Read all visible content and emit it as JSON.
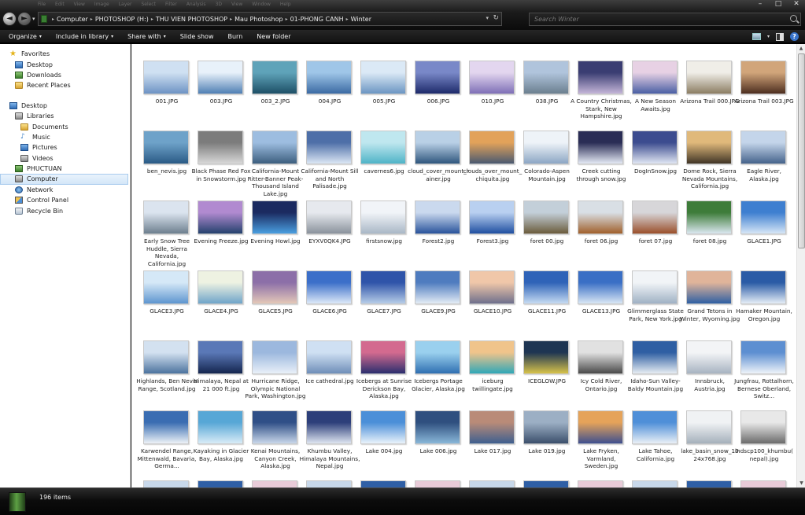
{
  "window": {
    "menu_ghost": [
      "File",
      "Edit",
      "View",
      "Image",
      "Layer",
      "Select",
      "Filter",
      "Analysis",
      "3D",
      "View",
      "Window",
      "Help"
    ],
    "controls": {
      "minimize": "–",
      "maximize": "□",
      "close": "✕"
    }
  },
  "nav": {
    "back": "◄",
    "forward": "►",
    "history": "▾"
  },
  "address": {
    "crumbs": [
      "Computer",
      "PHOTOSHOP (H:)",
      "THU VIEN PHOTOSHOP",
      "Mau Photoshop",
      "01-PHONG CANH",
      "Winter"
    ],
    "separator": "▸",
    "dropdown": "▾",
    "refresh": "↻"
  },
  "search": {
    "placeholder": "Search Winter"
  },
  "toolbar": {
    "organize": "Organize",
    "include": "Include in library",
    "share": "Share with",
    "slideshow": "Slide show",
    "burn": "Burn",
    "newfolder": "New folder",
    "caret": "▾",
    "help": "?"
  },
  "sidebar": {
    "favorites": {
      "label": "Favorites",
      "items": [
        "Desktop",
        "Downloads",
        "Recent Places"
      ]
    },
    "desktop": "Desktop",
    "libraries": {
      "label": "Libraries",
      "items": [
        "Documents",
        "Music",
        "Pictures",
        "Videos"
      ]
    },
    "user": "PHUCTUAN",
    "computer": "Computer",
    "network": "Network",
    "control_panel": "Control Panel",
    "recycle_bin": "Recycle Bin"
  },
  "files": [
    "001.JPG",
    "003.JPG",
    "003_2.JPG",
    "004.JPG",
    "005.JPG",
    "006.JPG",
    "010.JPG",
    "038.JPG",
    "A Country Christmas, Stark, New Hampshire.jpg",
    "A New Season Awaits.jpg",
    "Arizona Trail 000.JPG",
    "Arizona Trail 003.JPG",
    "ben_nevis.jpg",
    "Black Phase Red Fox in Snowstorm.jpg",
    "California-Mount Ritter-Banner Peak-Thousand Island Lake.jpg",
    "California-Mount Sill and North Palisade.jpg",
    "cavernes6.jpg",
    "cloud_cover_mount_rainer.jpg",
    "clouds_over_mount_chiquita.jpg",
    "Colorado-Aspen Mountain.jpg",
    "Creek cutting through snow.jpg",
    "DogInSnow.jpg",
    "Dome Rock, Sierra Nevada Mountains, California.jpg",
    "Eagle River, Alaska.jpg",
    "Early Snow Tree Huddle, Sierra Nevada, California.jpg",
    "Evening Freeze.jpg",
    "Evening Howl.jpg",
    "EYXV0QK4.JPG",
    "firstsnow.jpg",
    "Forest2.jpg",
    "Forest3.jpg",
    "foret 00.jpg",
    "foret 06.jpg",
    "foret 07.jpg",
    "foret 08.jpg",
    "GLACE1.JPG",
    "GLACE3.JPG",
    "GLACE4.JPG",
    "GLACE5.JPG",
    "GLACE6.JPG",
    "GLACE7.JPG",
    "GLACE9.JPG",
    "GLACE10.JPG",
    "GLACE11.JPG",
    "GLACE13.JPG",
    "Glimmerglass State Park, New York.jpg",
    "Grand Tetons in Winter, Wyoming.jpg",
    "Hamaker Mountain, Oregon.jpg",
    "Highlands, Ben Nevis Range, Scotland.jpg",
    "Himalaya, Nepal at 21 000 ft.jpg",
    "Hurricane Ridge, Olympic National Park, Washington.jpg",
    "Ice cathedral.jpg",
    "Icebergs at Sunrise Derickson Bay, Alaska.jpg",
    "Icebergs Portage Glacier, Alaska.jpg",
    "iceburg twillingate.jpg",
    "ICEGLOW.JPG",
    "Icy Cold River, Ontario.jpg",
    "Idaho-Sun Valley-Baldy Mountain.jpg",
    "Innsbruck, Austria.jpg",
    "Jungfrau, Rottalhorn, Bernese Oberland, Switz...",
    "Karwendel Range, Mittenwald, Bavaria, Germa...",
    "Kayaking in Glacier Bay, Alaska.jpg",
    "Kenai Mountains, Canyon Creek, Alaska.jpg",
    "Khumbu Valley, Himalaya Mountains, Nepal.jpg",
    "Lake 004.jpg",
    "Lake 006.jpg",
    "Lake 017.jpg",
    "Lake 019.jpg",
    "Lake Fryken, Varmland, Sweden.jpg",
    "Lake Tahoe, California.jpg",
    "lake_basin_snow_1024x768.jpg",
    "lndscp100_khumbu(nepal).jpg"
  ],
  "thumb_colors": [
    [
      "#cfe0f2",
      "#6d93c4"
    ],
    [
      "#e8f1fa",
      "#4f7fb4"
    ],
    [
      "#5fa3b9",
      "#1d4f66"
    ],
    [
      "#9fc6e8",
      "#3b6aa3"
    ],
    [
      "#dbe9f6",
      "#6b95c2"
    ],
    [
      "#7988c8",
      "#1d2a6a"
    ],
    [
      "#e3d6ef",
      "#7e6fb6"
    ],
    [
      "#b0c4dc",
      "#6b7f8f"
    ],
    [
      "#3a3d72",
      "#c4b5d8"
    ],
    [
      "#e7d1e4",
      "#4a5fa4"
    ],
    [
      "#f0eee8",
      "#8b7d63"
    ],
    [
      "#d1a57a",
      "#4d2e1f"
    ],
    [
      "#6ea2c9",
      "#2a5a85"
    ],
    [
      "#7c7c7c",
      "#d8d8d8"
    ],
    [
      "#9dbde0",
      "#3c5e7e"
    ],
    [
      "#4e6fa8",
      "#dbe6f4"
    ],
    [
      "#bfe7ef",
      "#4fb3c7"
    ],
    [
      "#b9d0e6",
      "#2f567d"
    ],
    [
      "#e2a25a",
      "#4a5970"
    ],
    [
      "#eef3f8",
      "#8ca6c4"
    ],
    [
      "#2a2d55",
      "#e5eaf5"
    ],
    [
      "#3c4c8f",
      "#e0e6f3"
    ],
    [
      "#e0b97b",
      "#403526"
    ],
    [
      "#c4d5ea",
      "#45638b"
    ],
    [
      "#dbe4ef",
      "#6d7f8e"
    ],
    [
      "#b18ad0",
      "#24416d"
    ],
    [
      "#1b2a60",
      "#4a9fe0"
    ],
    [
      "#e6e9ee",
      "#8a929c"
    ],
    [
      "#f1f4f8",
      "#a9b7c6"
    ],
    [
      "#cad9ee",
      "#29539b"
    ],
    [
      "#b9d0f0",
      "#1f4fa0"
    ],
    [
      "#c3cfd9",
      "#6b5c3c"
    ],
    [
      "#d9dfe5",
      "#a0602b"
    ],
    [
      "#d7d6d9",
      "#9a4f2a"
    ],
    [
      "#3e7c3a",
      "#dbe7f0"
    ],
    [
      "#3e7fd0",
      "#d6e6f6"
    ],
    [
      "#d5e8f7",
      "#5e95cf"
    ],
    [
      "#eef2e2",
      "#6fa4c9"
    ],
    [
      "#8c6fa8",
      "#e4c8b8"
    ],
    [
      "#3c6fc9",
      "#dde9f8"
    ],
    [
      "#2f54a9",
      "#b7cde8"
    ],
    [
      "#4f7cbf",
      "#e4ecf5"
    ],
    [
      "#f0c7a9",
      "#6e6f8c"
    ],
    [
      "#2f63b8",
      "#c6dbf2"
    ],
    [
      "#3a6fc5",
      "#d9e6f4"
    ],
    [
      "#f1f4f7",
      "#9fb1c4"
    ],
    [
      "#e0b49a",
      "#2e5fa3"
    ],
    [
      "#2a5ba6",
      "#e6eef7"
    ],
    [
      "#d3e1f0",
      "#4c739e"
    ],
    [
      "#5a78b7",
      "#14254e"
    ],
    [
      "#9cb8de",
      "#e9f0f8"
    ],
    [
      "#cfe0f3",
      "#6f8eb8"
    ],
    [
      "#d36a8f",
      "#2a2e6e"
    ],
    [
      "#9ad0ee",
      "#2f6fb1"
    ],
    [
      "#f0c48b",
      "#2fa7b7"
    ],
    [
      "#1e3552",
      "#d8c34a"
    ],
    [
      "#e1e1e1",
      "#494949"
    ],
    [
      "#2f5fa3",
      "#e7edf3"
    ],
    [
      "#f3f4f6",
      "#a7b3c1"
    ],
    [
      "#5d8fd1",
      "#eef3f9"
    ],
    [
      "#3a6db2",
      "#eef2f7"
    ],
    [
      "#57a7d6",
      "#d9ecf7"
    ],
    [
      "#2f4f87",
      "#c9d7ea"
    ],
    [
      "#2d3f7a",
      "#dfe6f1"
    ],
    [
      "#4b8fd8",
      "#eaf3fb"
    ],
    [
      "#2f4f7f",
      "#8ab8d9"
    ],
    [
      "#b98b78",
      "#3e5f8f"
    ],
    [
      "#9cafc4",
      "#3b4f6b"
    ],
    [
      "#e5a35a",
      "#3e4f8f"
    ],
    [
      "#4f8fd8",
      "#eaf0f6"
    ],
    [
      "#f0f2f4",
      "#a5b0bb"
    ],
    [
      "#e8e8e8",
      "#6b6b6b"
    ]
  ],
  "status": {
    "count": "196 items"
  }
}
